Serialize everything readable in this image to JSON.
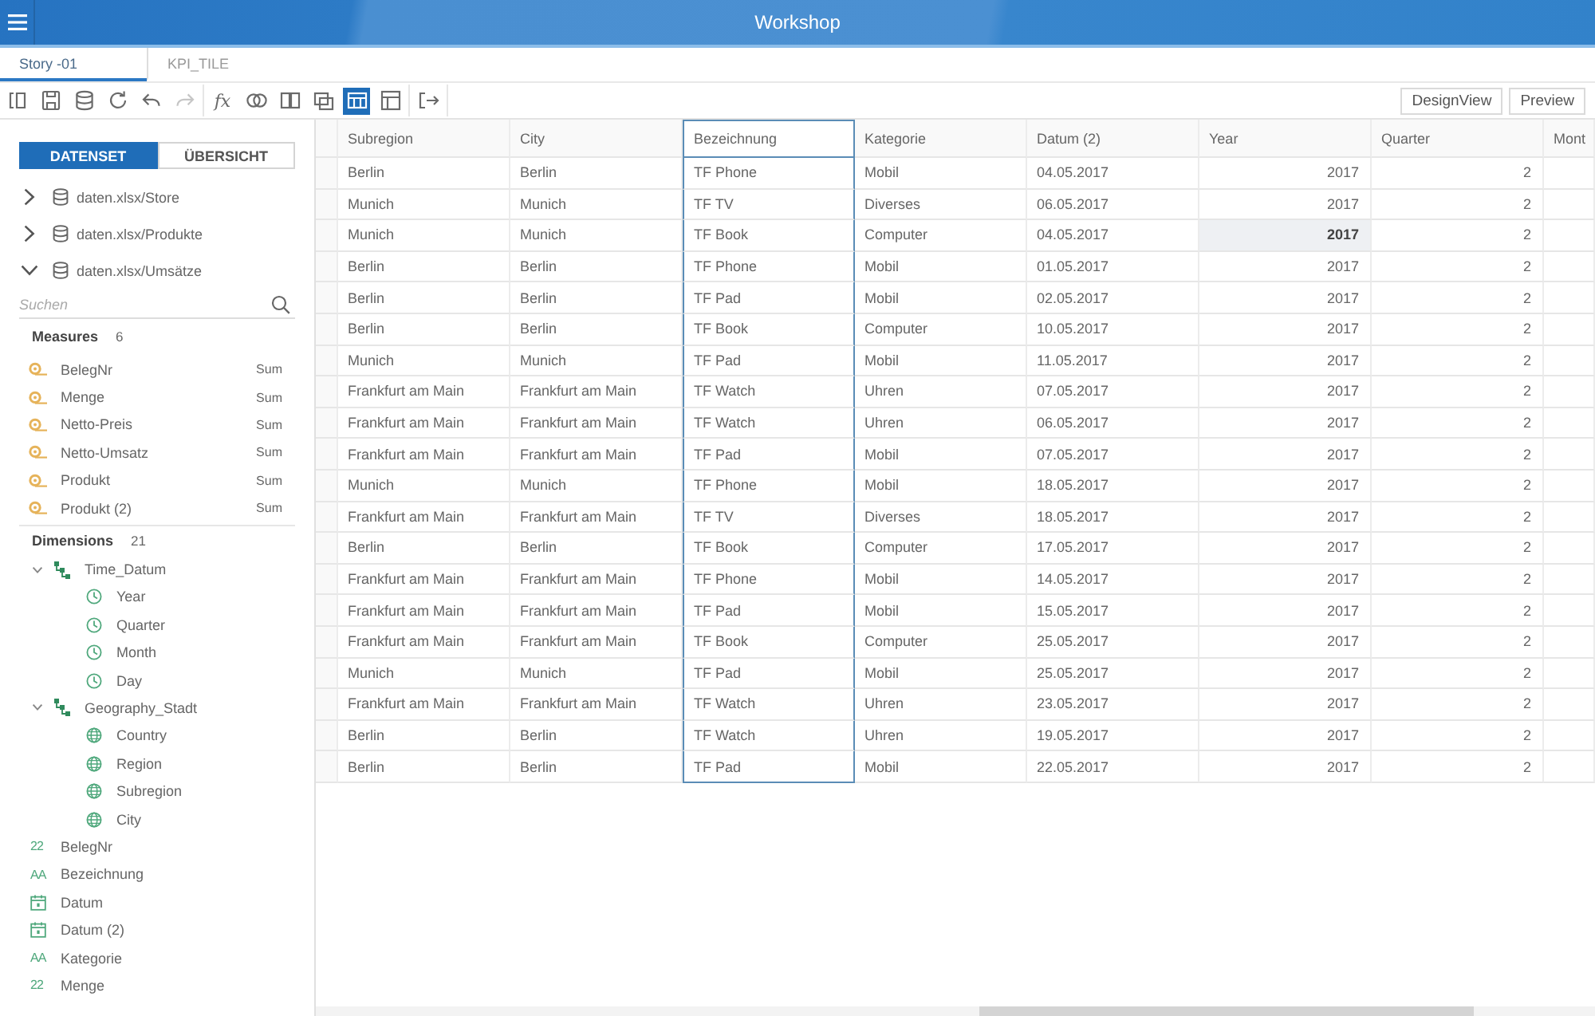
{
  "header": {
    "title": "Workshop"
  },
  "tabs": [
    {
      "label": "Story -01",
      "selected": true
    },
    {
      "label": "KPI_TILE",
      "selected": false
    }
  ],
  "toolbar": {
    "groups": [
      [
        {
          "kind": "sidebar",
          "selected": false,
          "disabled": false
        },
        {
          "kind": "save",
          "selected": false,
          "disabled": false
        },
        {
          "kind": "database",
          "selected": false,
          "disabled": false
        },
        {
          "kind": "refresh",
          "selected": false,
          "disabled": false
        },
        {
          "kind": "undo",
          "selected": false,
          "disabled": false
        },
        {
          "kind": "redo",
          "selected": false,
          "disabled": true
        }
      ],
      [
        {
          "kind": "formula",
          "label": "fx",
          "selected": false,
          "disabled": false
        },
        {
          "kind": "blend",
          "selected": false,
          "disabled": false
        },
        {
          "kind": "split",
          "selected": false,
          "disabled": false
        },
        {
          "kind": "copy",
          "selected": false,
          "disabled": false
        },
        {
          "kind": "table",
          "selected": true,
          "disabled": false
        },
        {
          "kind": "layout",
          "selected": false,
          "disabled": false
        }
      ],
      [
        {
          "kind": "export",
          "selected": false,
          "disabled": false
        }
      ]
    ],
    "buttons": [
      "DesignView",
      "Preview"
    ]
  },
  "panel": {
    "segments": [
      {
        "label": "DATENSET",
        "selected": true
      },
      {
        "label": "ÜBERSICHT",
        "selected": false
      }
    ],
    "datasets": [
      {
        "label": "daten.xlsx/Store",
        "expanded": false
      },
      {
        "label": "daten.xlsx/Produkte",
        "expanded": false
      },
      {
        "label": "daten.xlsx/Umsätze",
        "expanded": true
      }
    ],
    "search": {
      "placeholder": "Suchen"
    },
    "measures": {
      "title": "Measures",
      "count": "6",
      "items": [
        {
          "label": "BelegNr",
          "aggregation": "Sum"
        },
        {
          "label": "Menge",
          "aggregation": "Sum"
        },
        {
          "label": "Netto-Preis",
          "aggregation": "Sum"
        },
        {
          "label": "Netto-Umsatz",
          "aggregation": "Sum"
        },
        {
          "label": "Produkt",
          "aggregation": "Sum"
        },
        {
          "label": "Produkt (2)",
          "aggregation": "Sum"
        }
      ]
    },
    "dimensions": {
      "title": "Dimensions",
      "count": "21",
      "items": [
        {
          "kind": "hierarchy",
          "label": "Time_Datum",
          "expanded": true,
          "children": [
            {
              "kind": "time",
              "label": "Year"
            },
            {
              "kind": "time",
              "label": "Quarter"
            },
            {
              "kind": "time",
              "label": "Month"
            },
            {
              "kind": "time",
              "label": "Day"
            }
          ]
        },
        {
          "kind": "hierarchy",
          "label": "Geography_Stadt",
          "expanded": true,
          "children": [
            {
              "kind": "geo",
              "label": "Country"
            },
            {
              "kind": "geo",
              "label": "Region"
            },
            {
              "kind": "geo",
              "label": "Subregion"
            },
            {
              "kind": "geo",
              "label": "City"
            }
          ]
        },
        {
          "kind": "number",
          "glyph": "22",
          "label": "BelegNr"
        },
        {
          "kind": "text",
          "glyph": "AA",
          "label": "Bezeichnung"
        },
        {
          "kind": "date",
          "label": "Datum"
        },
        {
          "kind": "date",
          "label": "Datum (2)"
        },
        {
          "kind": "text",
          "glyph": "AA",
          "label": "Kategorie"
        },
        {
          "kind": "number",
          "glyph": "22",
          "label": "Menge"
        }
      ]
    }
  },
  "table": {
    "columns": [
      {
        "label": "Subregion",
        "kind": "text",
        "selected": false
      },
      {
        "label": "City",
        "kind": "text",
        "selected": false
      },
      {
        "label": "Bezeichnung",
        "kind": "text",
        "selected": true
      },
      {
        "label": "Kategorie",
        "kind": "text",
        "selected": false
      },
      {
        "label": "Datum (2)",
        "kind": "text",
        "selected": false
      },
      {
        "label": "Year",
        "kind": "number",
        "selected": false
      },
      {
        "label": "Quarter",
        "kind": "number",
        "selected": false
      },
      {
        "label": "Mont",
        "kind": "text",
        "selected": false
      }
    ],
    "rows": [
      {
        "cells": [
          {
            "text": "Berlin",
            "selected": false
          },
          {
            "text": "Berlin",
            "selected": false
          },
          {
            "text": "TF Phone",
            "selected": false
          },
          {
            "text": "Mobil",
            "selected": false
          },
          {
            "text": "04.05.2017",
            "selected": false
          },
          {
            "text": "2017",
            "selected": false
          },
          {
            "text": "2",
            "selected": false
          }
        ]
      },
      {
        "cells": [
          {
            "text": "Munich",
            "selected": false
          },
          {
            "text": "Munich",
            "selected": false
          },
          {
            "text": "TF TV",
            "selected": false
          },
          {
            "text": "Diverses",
            "selected": false
          },
          {
            "text": "06.05.2017",
            "selected": false
          },
          {
            "text": "2017",
            "selected": false
          },
          {
            "text": "2",
            "selected": false
          }
        ]
      },
      {
        "cells": [
          {
            "text": "Munich",
            "selected": false
          },
          {
            "text": "Munich",
            "selected": false
          },
          {
            "text": "TF Book",
            "selected": false
          },
          {
            "text": "Computer",
            "selected": false
          },
          {
            "text": "04.05.2017",
            "selected": false
          },
          {
            "text": "2017",
            "selected": true
          },
          {
            "text": "2",
            "selected": false
          }
        ]
      },
      {
        "cells": [
          {
            "text": "Berlin",
            "selected": false
          },
          {
            "text": "Berlin",
            "selected": false
          },
          {
            "text": "TF Phone",
            "selected": false
          },
          {
            "text": "Mobil",
            "selected": false
          },
          {
            "text": "01.05.2017",
            "selected": false
          },
          {
            "text": "2017",
            "selected": false
          },
          {
            "text": "2",
            "selected": false
          }
        ]
      },
      {
        "cells": [
          {
            "text": "Berlin",
            "selected": false
          },
          {
            "text": "Berlin",
            "selected": false
          },
          {
            "text": "TF Pad",
            "selected": false
          },
          {
            "text": "Mobil",
            "selected": false
          },
          {
            "text": "02.05.2017",
            "selected": false
          },
          {
            "text": "2017",
            "selected": false
          },
          {
            "text": "2",
            "selected": false
          }
        ]
      },
      {
        "cells": [
          {
            "text": "Berlin",
            "selected": false
          },
          {
            "text": "Berlin",
            "selected": false
          },
          {
            "text": "TF Book",
            "selected": false
          },
          {
            "text": "Computer",
            "selected": false
          },
          {
            "text": "10.05.2017",
            "selected": false
          },
          {
            "text": "2017",
            "selected": false
          },
          {
            "text": "2",
            "selected": false
          }
        ]
      },
      {
        "cells": [
          {
            "text": "Munich",
            "selected": false
          },
          {
            "text": "Munich",
            "selected": false
          },
          {
            "text": "TF Pad",
            "selected": false
          },
          {
            "text": "Mobil",
            "selected": false
          },
          {
            "text": "11.05.2017",
            "selected": false
          },
          {
            "text": "2017",
            "selected": false
          },
          {
            "text": "2",
            "selected": false
          }
        ]
      },
      {
        "cells": [
          {
            "text": "Frankfurt am Main",
            "selected": false
          },
          {
            "text": "Frankfurt am Main",
            "selected": false
          },
          {
            "text": "TF Watch",
            "selected": false
          },
          {
            "text": "Uhren",
            "selected": false
          },
          {
            "text": "07.05.2017",
            "selected": false
          },
          {
            "text": "2017",
            "selected": false
          },
          {
            "text": "2",
            "selected": false
          }
        ]
      },
      {
        "cells": [
          {
            "text": "Frankfurt am Main",
            "selected": false
          },
          {
            "text": "Frankfurt am Main",
            "selected": false
          },
          {
            "text": "TF Watch",
            "selected": false
          },
          {
            "text": "Uhren",
            "selected": false
          },
          {
            "text": "06.05.2017",
            "selected": false
          },
          {
            "text": "2017",
            "selected": false
          },
          {
            "text": "2",
            "selected": false
          }
        ]
      },
      {
        "cells": [
          {
            "text": "Frankfurt am Main",
            "selected": false
          },
          {
            "text": "Frankfurt am Main",
            "selected": false
          },
          {
            "text": "TF Pad",
            "selected": false
          },
          {
            "text": "Mobil",
            "selected": false
          },
          {
            "text": "07.05.2017",
            "selected": false
          },
          {
            "text": "2017",
            "selected": false
          },
          {
            "text": "2",
            "selected": false
          }
        ]
      },
      {
        "cells": [
          {
            "text": "Munich",
            "selected": false
          },
          {
            "text": "Munich",
            "selected": false
          },
          {
            "text": "TF Phone",
            "selected": false
          },
          {
            "text": "Mobil",
            "selected": false
          },
          {
            "text": "18.05.2017",
            "selected": false
          },
          {
            "text": "2017",
            "selected": false
          },
          {
            "text": "2",
            "selected": false
          }
        ]
      },
      {
        "cells": [
          {
            "text": "Frankfurt am Main",
            "selected": false
          },
          {
            "text": "Frankfurt am Main",
            "selected": false
          },
          {
            "text": "TF TV",
            "selected": false
          },
          {
            "text": "Diverses",
            "selected": false
          },
          {
            "text": "18.05.2017",
            "selected": false
          },
          {
            "text": "2017",
            "selected": false
          },
          {
            "text": "2",
            "selected": false
          }
        ]
      },
      {
        "cells": [
          {
            "text": "Berlin",
            "selected": false
          },
          {
            "text": "Berlin",
            "selected": false
          },
          {
            "text": "TF Book",
            "selected": false
          },
          {
            "text": "Computer",
            "selected": false
          },
          {
            "text": "17.05.2017",
            "selected": false
          },
          {
            "text": "2017",
            "selected": false
          },
          {
            "text": "2",
            "selected": false
          }
        ]
      },
      {
        "cells": [
          {
            "text": "Frankfurt am Main",
            "selected": false
          },
          {
            "text": "Frankfurt am Main",
            "selected": false
          },
          {
            "text": "TF Phone",
            "selected": false
          },
          {
            "text": "Mobil",
            "selected": false
          },
          {
            "text": "14.05.2017",
            "selected": false
          },
          {
            "text": "2017",
            "selected": false
          },
          {
            "text": "2",
            "selected": false
          }
        ]
      },
      {
        "cells": [
          {
            "text": "Frankfurt am Main",
            "selected": false
          },
          {
            "text": "Frankfurt am Main",
            "selected": false
          },
          {
            "text": "TF Pad",
            "selected": false
          },
          {
            "text": "Mobil",
            "selected": false
          },
          {
            "text": "15.05.2017",
            "selected": false
          },
          {
            "text": "2017",
            "selected": false
          },
          {
            "text": "2",
            "selected": false
          }
        ]
      },
      {
        "cells": [
          {
            "text": "Frankfurt am Main",
            "selected": false
          },
          {
            "text": "Frankfurt am Main",
            "selected": false
          },
          {
            "text": "TF Book",
            "selected": false
          },
          {
            "text": "Computer",
            "selected": false
          },
          {
            "text": "25.05.2017",
            "selected": false
          },
          {
            "text": "2017",
            "selected": false
          },
          {
            "text": "2",
            "selected": false
          }
        ]
      },
      {
        "cells": [
          {
            "text": "Munich",
            "selected": false
          },
          {
            "text": "Munich",
            "selected": false
          },
          {
            "text": "TF Pad",
            "selected": false
          },
          {
            "text": "Mobil",
            "selected": false
          },
          {
            "text": "25.05.2017",
            "selected": false
          },
          {
            "text": "2017",
            "selected": false
          },
          {
            "text": "2",
            "selected": false
          }
        ]
      },
      {
        "cells": [
          {
            "text": "Frankfurt am Main",
            "selected": false
          },
          {
            "text": "Frankfurt am Main",
            "selected": false
          },
          {
            "text": "TF Watch",
            "selected": false
          },
          {
            "text": "Uhren",
            "selected": false
          },
          {
            "text": "23.05.2017",
            "selected": false
          },
          {
            "text": "2017",
            "selected": false
          },
          {
            "text": "2",
            "selected": false
          }
        ]
      },
      {
        "cells": [
          {
            "text": "Berlin",
            "selected": false
          },
          {
            "text": "Berlin",
            "selected": false
          },
          {
            "text": "TF Watch",
            "selected": false
          },
          {
            "text": "Uhren",
            "selected": false
          },
          {
            "text": "19.05.2017",
            "selected": false
          },
          {
            "text": "2017",
            "selected": false
          },
          {
            "text": "2",
            "selected": false
          }
        ]
      },
      {
        "cells": [
          {
            "text": "Berlin",
            "selected": false
          },
          {
            "text": "Berlin",
            "selected": false
          },
          {
            "text": "TF Pad",
            "selected": false
          },
          {
            "text": "Mobil",
            "selected": false
          },
          {
            "text": "22.05.2017",
            "selected": false
          },
          {
            "text": "2017",
            "selected": false
          },
          {
            "text": "2",
            "selected": false
          }
        ]
      }
    ]
  }
}
